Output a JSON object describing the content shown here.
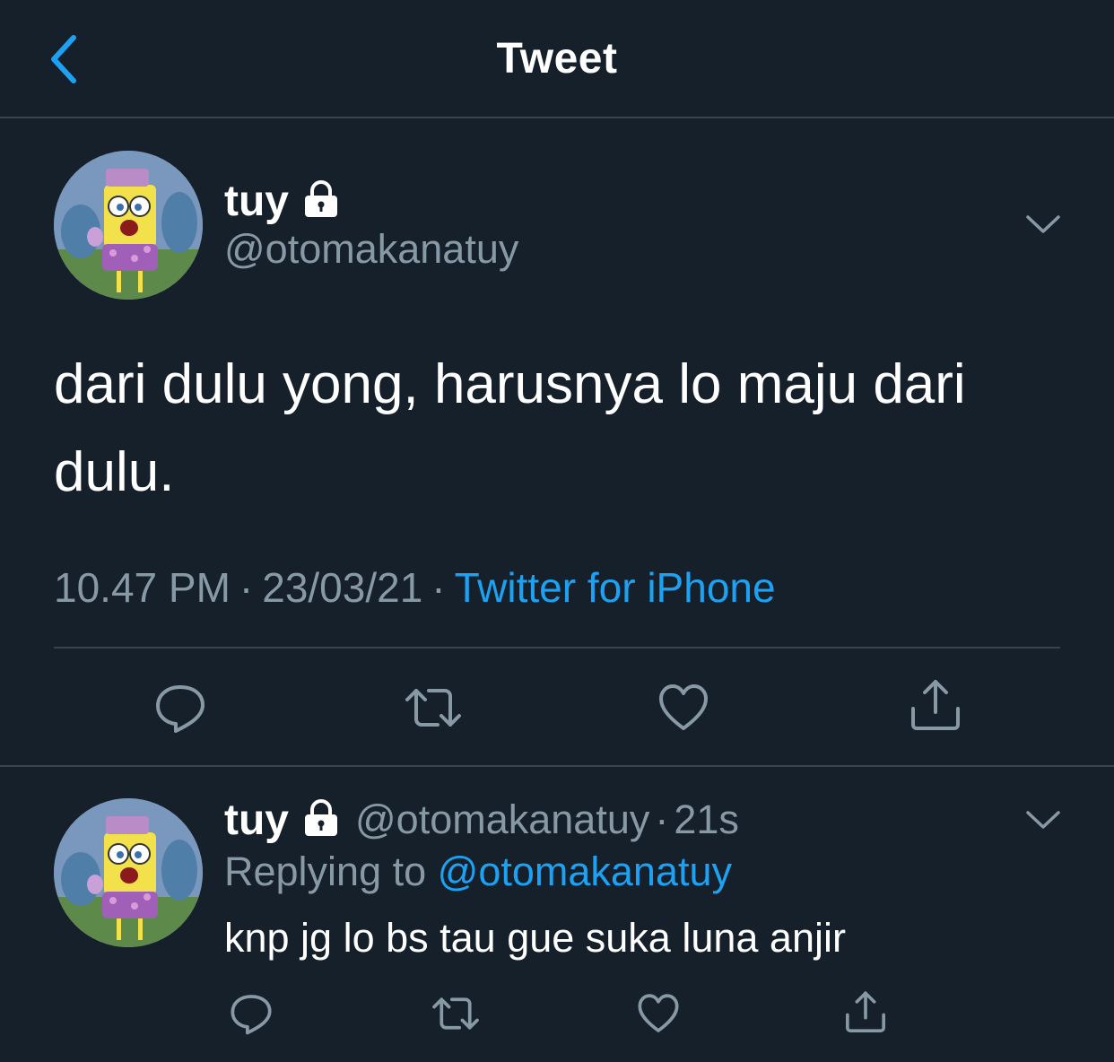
{
  "header": {
    "title": "Tweet",
    "back_icon": "chevron-left-icon"
  },
  "tweet": {
    "author_name": "tuy",
    "author_handle": "@otomakanatuy",
    "protected_icon": "lock-icon",
    "text": "dari dulu yong, harusnya lo maju dari dulu.",
    "time": "10.47 PM",
    "date": "23/03/21",
    "separator": "·",
    "source": "Twitter for iPhone",
    "actions": [
      "reply-icon",
      "retweet-icon",
      "like-icon",
      "share-icon"
    ]
  },
  "reply": {
    "author_name": "tuy",
    "author_handle": "@otomakanatuy",
    "separator": "·",
    "time_ago": "21s",
    "replying_prefix": "Replying to",
    "replying_to": "@otomakanatuy",
    "text": "knp jg lo bs tau gue suka luna anjir",
    "actions": [
      "reply-icon",
      "retweet-icon",
      "like-icon",
      "share-icon"
    ]
  },
  "colors": {
    "background": "#15202b",
    "divider": "#38444d",
    "secondary_text": "#8899a6",
    "accent": "#1da1f2",
    "primary_text": "#ffffff"
  }
}
